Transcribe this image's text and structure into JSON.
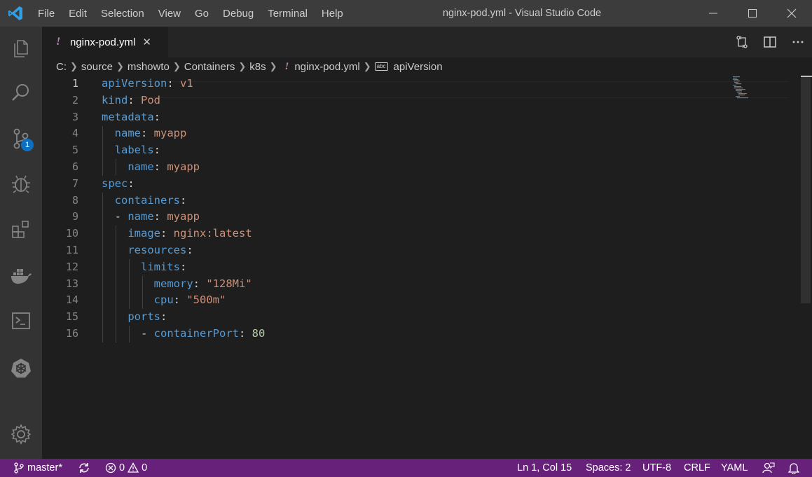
{
  "window": {
    "title": "nginx-pod.yml - Visual Studio Code",
    "menu": [
      "File",
      "Edit",
      "Selection",
      "View",
      "Go",
      "Debug",
      "Terminal",
      "Help"
    ]
  },
  "activity": {
    "items": [
      "explorer-icon",
      "search-icon",
      "source-control-icon",
      "debug-icon",
      "extensions-icon",
      "docker-icon",
      "remote-explorer-icon",
      "kubernetes-icon",
      "settings-gear-icon"
    ],
    "source_control_badge": "1"
  },
  "tab": {
    "marker": "!",
    "filename": "nginx-pod.yml",
    "close": "✕"
  },
  "breadcrumb": {
    "parts": [
      "C:",
      "source",
      "mshowto",
      "Containers",
      "k8s"
    ],
    "file_marker": "!",
    "file": "nginx-pod.yml",
    "symbol_icon": "abc",
    "symbol": "apiVersion"
  },
  "editor": {
    "line_numbers": [
      "1",
      "2",
      "3",
      "4",
      "5",
      "6",
      "7",
      "8",
      "9",
      "10",
      "11",
      "12",
      "13",
      "14",
      "15",
      "16"
    ],
    "lines": [
      {
        "indent": "",
        "dash": "",
        "key": "apiVersion",
        "colon": ":",
        "value": " v1",
        "vtype": "s"
      },
      {
        "indent": "",
        "dash": "",
        "key": "kind",
        "colon": ":",
        "value": " Pod",
        "vtype": "s"
      },
      {
        "indent": "",
        "dash": "",
        "key": "metadata",
        "colon": ":",
        "value": "",
        "vtype": "s"
      },
      {
        "indent": "  ",
        "dash": "",
        "key": "name",
        "colon": ":",
        "value": " myapp",
        "vtype": "s"
      },
      {
        "indent": "  ",
        "dash": "",
        "key": "labels",
        "colon": ":",
        "value": "",
        "vtype": "s"
      },
      {
        "indent": "    ",
        "dash": "",
        "key": "name",
        "colon": ":",
        "value": " myapp",
        "vtype": "s"
      },
      {
        "indent": "",
        "dash": "",
        "key": "spec",
        "colon": ":",
        "value": "",
        "vtype": "s"
      },
      {
        "indent": "  ",
        "dash": "",
        "key": "containers",
        "colon": ":",
        "value": "",
        "vtype": "s"
      },
      {
        "indent": "  ",
        "dash": "- ",
        "key": "name",
        "colon": ":",
        "value": " myapp",
        "vtype": "s"
      },
      {
        "indent": "    ",
        "dash": "",
        "key": "image",
        "colon": ":",
        "value": " nginx:latest",
        "vtype": "s"
      },
      {
        "indent": "    ",
        "dash": "",
        "key": "resources",
        "colon": ":",
        "value": "",
        "vtype": "s"
      },
      {
        "indent": "      ",
        "dash": "",
        "key": "limits",
        "colon": ":",
        "value": "",
        "vtype": "s"
      },
      {
        "indent": "        ",
        "dash": "",
        "key": "memory",
        "colon": ":",
        "value": " \"128Mi\"",
        "vtype": "s"
      },
      {
        "indent": "        ",
        "dash": "",
        "key": "cpu",
        "colon": ":",
        "value": " \"500m\"",
        "vtype": "s"
      },
      {
        "indent": "    ",
        "dash": "",
        "key": "ports",
        "colon": ":",
        "value": "",
        "vtype": "s"
      },
      {
        "indent": "      ",
        "dash": "- ",
        "key": "containerPort",
        "colon": ":",
        "value": " 80",
        "vtype": "n"
      }
    ]
  },
  "statusbar": {
    "branch": "master*",
    "errors": "0",
    "warnings": "0",
    "position": "Ln 1, Col 15",
    "spaces": "Spaces: 2",
    "encoding": "UTF-8",
    "eol": "CRLF",
    "language": "YAML"
  },
  "colors": {
    "statusbar": "#68217a",
    "key": "#569cd6",
    "string": "#ce9178",
    "number": "#b5cea8",
    "marker": "#c586c0"
  }
}
